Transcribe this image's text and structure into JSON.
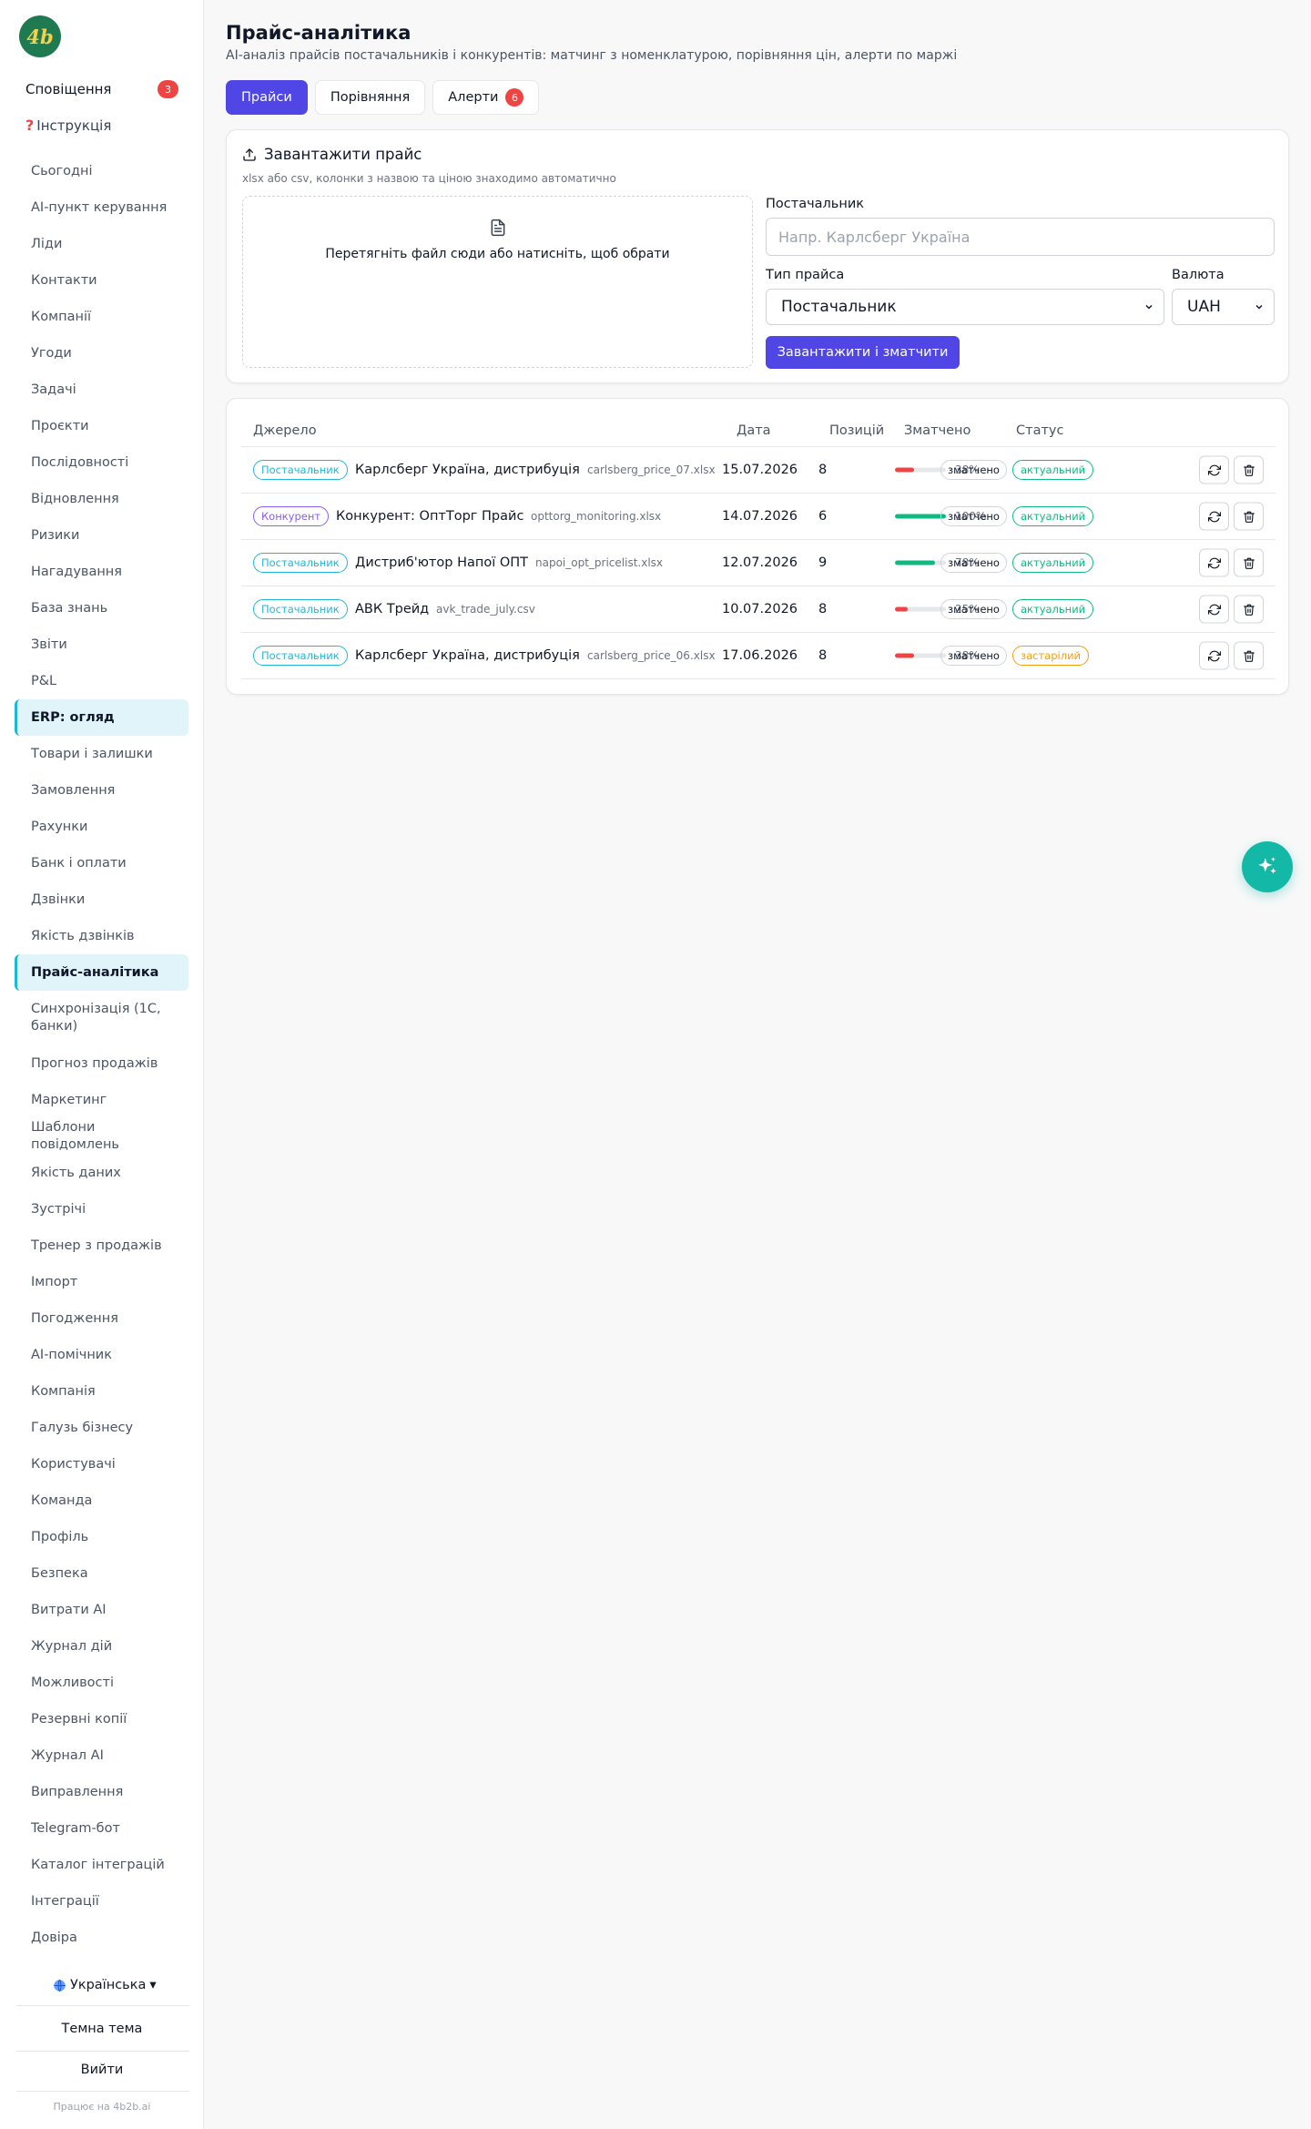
{
  "sidebar": {
    "logo_text": "4b",
    "notifications": {
      "label": "Сповіщення",
      "count": "3"
    },
    "instruction": {
      "icon": "?",
      "label": "Інструкція"
    },
    "items": [
      {
        "label": "Сьогодні",
        "active": false
      },
      {
        "label": "AI-пункт керування",
        "active": false
      },
      {
        "label": "Ліди",
        "active": false
      },
      {
        "label": "Контакти",
        "active": false
      },
      {
        "label": "Компанії",
        "active": false
      },
      {
        "label": "Угоди",
        "active": false
      },
      {
        "label": "Задачі",
        "active": false
      },
      {
        "label": "Проєкти",
        "active": false
      },
      {
        "label": "Послідовності",
        "active": false
      },
      {
        "label": "Відновлення",
        "active": false
      },
      {
        "label": "Ризики",
        "active": false
      },
      {
        "label": "Нагадування",
        "active": false
      },
      {
        "label": "База знань",
        "active": false
      },
      {
        "label": "Звіти",
        "active": false
      },
      {
        "label": "P&L",
        "active": false
      },
      {
        "label": "ERP: огляд",
        "active": true
      },
      {
        "label": "Товари і залишки",
        "active": false
      },
      {
        "label": "Замовлення",
        "active": false
      },
      {
        "label": "Рахунки",
        "active": false
      },
      {
        "label": "Банк і оплати",
        "active": false
      },
      {
        "label": "Дзвінки",
        "active": false
      },
      {
        "label": "Якість дзвінків",
        "active": false
      },
      {
        "label": "Прайс-аналітика",
        "active": true
      },
      {
        "label": "Синхронізація (1С, банки)",
        "active": false
      },
      {
        "label": "Прогноз продажів",
        "active": false
      },
      {
        "label": "Маркетинг",
        "active": false
      },
      {
        "label": "Шаблони повідомлень",
        "active": false
      },
      {
        "label": "Якість даних",
        "active": false
      },
      {
        "label": "Зустрічі",
        "active": false
      },
      {
        "label": "Тренер з продажів",
        "active": false
      },
      {
        "label": "Імпорт",
        "active": false
      },
      {
        "label": "Погодження",
        "active": false
      },
      {
        "label": "AI-помічник",
        "active": false
      },
      {
        "label": "Компанія",
        "active": false
      },
      {
        "label": "Галузь бізнесу",
        "active": false
      },
      {
        "label": "Користувачі",
        "active": false
      },
      {
        "label": "Команда",
        "active": false
      },
      {
        "label": "Профіль",
        "active": false
      },
      {
        "label": "Безпека",
        "active": false
      },
      {
        "label": "Витрати AI",
        "active": false
      },
      {
        "label": "Журнал дій",
        "active": false
      },
      {
        "label": "Можливості",
        "active": false
      },
      {
        "label": "Резервні копії",
        "active": false
      },
      {
        "label": "Журнал AI",
        "active": false
      },
      {
        "label": "Виправлення",
        "active": false
      },
      {
        "label": "Telegram-бот",
        "active": false
      },
      {
        "label": "Каталог інтеграцій",
        "active": false
      },
      {
        "label": "Інтеграції",
        "active": false
      },
      {
        "label": "Довіра",
        "active": false
      }
    ],
    "language": "Українська",
    "language_caret": "▾",
    "theme_label": "Темна тема",
    "logout_label": "Вийти",
    "powered_by": "Працює на 4b2b.ai"
  },
  "header": {
    "title": "Прайс-аналітика",
    "subtitle": "AI-аналіз прайсів постачальників і конкурентів: матчинг з номенклатурою, порівняння цін, алерти по маржі"
  },
  "tabs": [
    {
      "label": "Прайси",
      "active": true,
      "count": ""
    },
    {
      "label": "Порівняння",
      "active": false,
      "count": ""
    },
    {
      "label": "Алерти",
      "active": false,
      "count": "6"
    }
  ],
  "upload": {
    "title": "Завантажити прайс",
    "hint": "xlsx або csv, колонки з назвою та ціною знаходимо автоматично",
    "dropzone_text": "Перетягніть файл сюди або натисніть, щоб обрати",
    "supplier_label": "Постачальник",
    "supplier_placeholder": "Напр. Карлсберг Україна",
    "price_type_label": "Тип прайса",
    "price_type_value": "Постачальник",
    "currency_label": "Валюта",
    "currency_value": "UAH",
    "submit_label": "Завантажити і зматчити"
  },
  "table": {
    "headers": {
      "source": "Джерело",
      "date": "Дата",
      "positions": "Позицій",
      "matched": "Зматчено",
      "status": "Статус"
    },
    "rows": [
      {
        "type": "Постачальник",
        "kind": "supplier",
        "name": "Карлсберг Україна, дистрибуція",
        "file": "carlsberg_price_07.xlsx",
        "date": "15.07.2026",
        "positions": "8",
        "matched_pct": 38,
        "matched_label": "38%",
        "status": "зматчено",
        "freshness": "актуальний",
        "fresh": true
      },
      {
        "type": "Конкурент",
        "kind": "competitor",
        "name": "Конкурент: ОптТорг Прайс",
        "file": "opttorg_monitoring.xlsx",
        "date": "14.07.2026",
        "positions": "6",
        "matched_pct": 100,
        "matched_label": "100%",
        "status": "зматчено",
        "freshness": "актуальний",
        "fresh": true
      },
      {
        "type": "Постачальник",
        "kind": "supplier",
        "name": "Дистриб'ютор Напої ОПТ",
        "file": "napoi_opt_pricelist.xlsx",
        "date": "12.07.2026",
        "positions": "9",
        "matched_pct": 78,
        "matched_label": "78%",
        "status": "зматчено",
        "freshness": "актуальний",
        "fresh": true
      },
      {
        "type": "Постачальник",
        "kind": "supplier",
        "name": "АВК Трейд",
        "file": "avk_trade_july.csv",
        "date": "10.07.2026",
        "positions": "8",
        "matched_pct": 25,
        "matched_label": "25%",
        "status": "зматчено",
        "freshness": "актуальний",
        "fresh": true
      },
      {
        "type": "Постачальник",
        "kind": "supplier",
        "name": "Карлсберг Україна, дистрибуція",
        "file": "carlsberg_price_06.xlsx",
        "date": "17.06.2026",
        "positions": "8",
        "matched_pct": 38,
        "matched_label": "38%",
        "status": "зматчено",
        "freshness": "застарілий",
        "fresh": false
      }
    ]
  },
  "colors": {
    "accent": "#4f46e5",
    "sidebar_active_bg": "#e0f4fa",
    "sidebar_active_border": "#22b6d6",
    "supplier_badge": "#22b6d6",
    "competitor_badge": "#8b5cf6",
    "bar_high": "#10b981",
    "bar_low": "#ef4444",
    "fresh": "#10b981",
    "stale": "#f59e0b",
    "fab": "#14b8a6",
    "notification_badge": "#ef4444"
  },
  "icons": {
    "upload": "upload-icon",
    "file": "file-icon",
    "refresh": "refresh-icon",
    "trash": "trash-icon",
    "globe": "globe-icon",
    "sparkles": "sparkles-icon"
  }
}
